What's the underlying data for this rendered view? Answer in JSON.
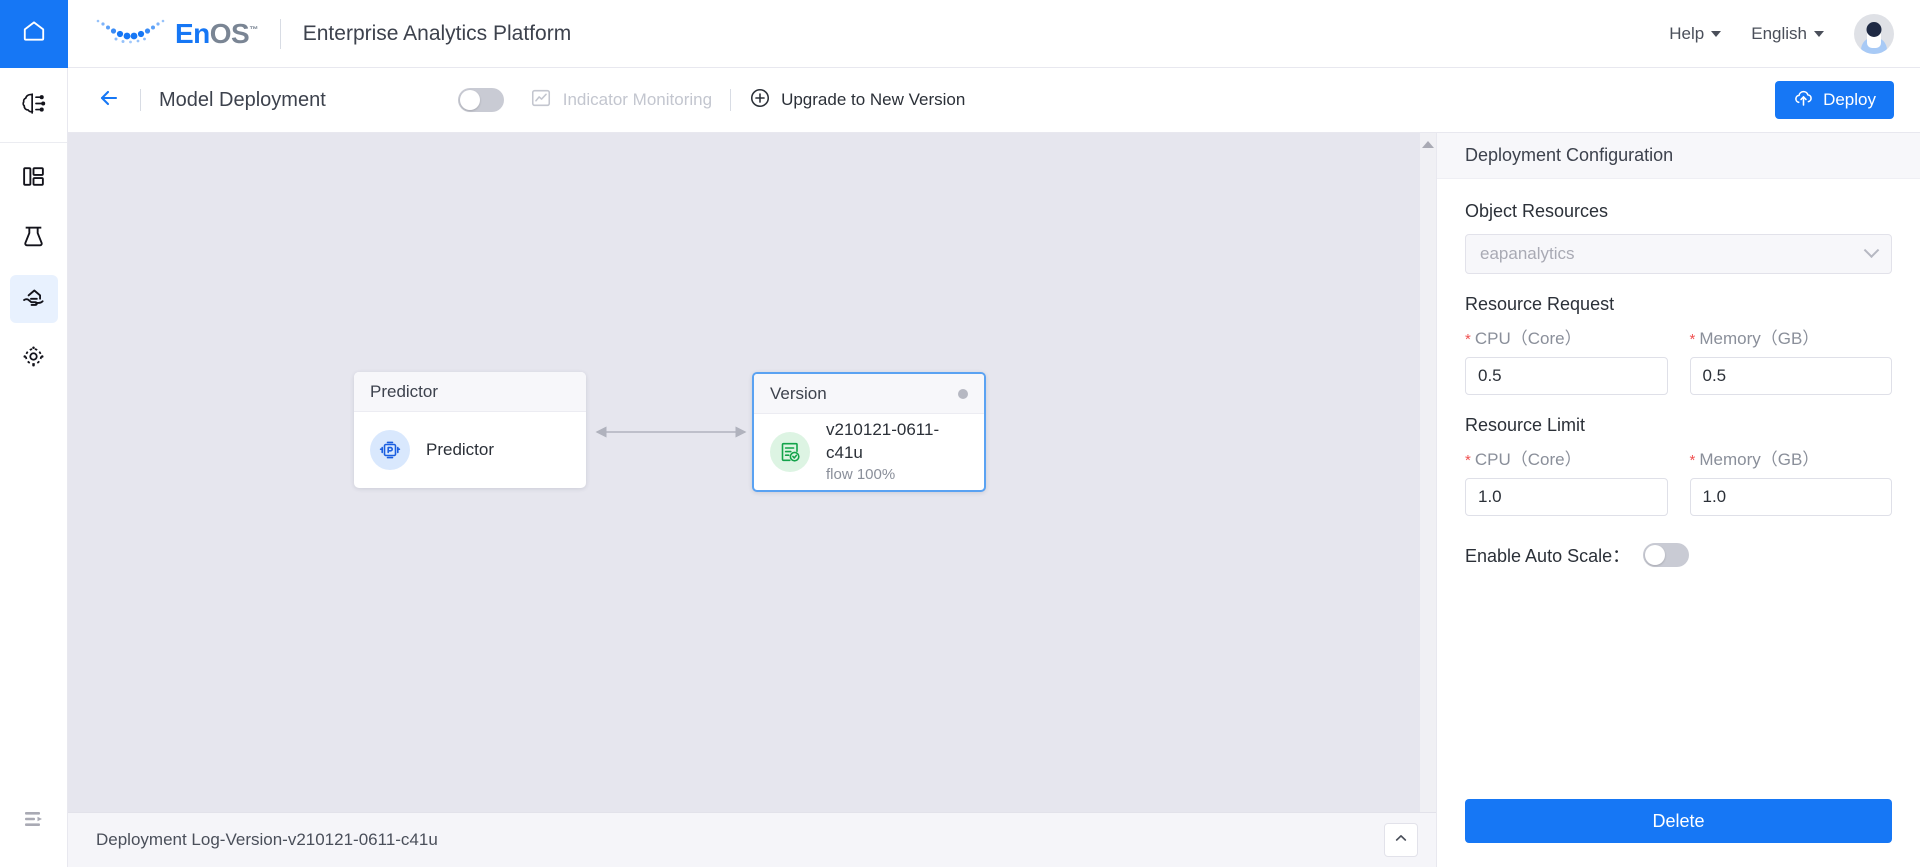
{
  "header": {
    "home_icon": "home-icon",
    "logo_en": "En",
    "logo_os": "OS",
    "logo_tm": "™",
    "platform_title": "Enterprise Analytics Platform",
    "help_label": "Help",
    "language_label": "English",
    "avatar_icon": "user-avatar-icon"
  },
  "sidebar": {
    "items": [
      {
        "name": "sidebar-item-ai-model",
        "icon": "brain-network-icon",
        "active": false
      },
      {
        "name": "sidebar-item-dashboard",
        "icon": "dashboard-grid-icon",
        "active": false
      },
      {
        "name": "sidebar-item-lab",
        "icon": "flask-icon",
        "active": false
      },
      {
        "name": "sidebar-item-deployment",
        "icon": "hand-deploy-icon",
        "active": true
      },
      {
        "name": "sidebar-item-settings",
        "icon": "gear-target-icon",
        "active": false
      }
    ],
    "collapse_icon": "collapse-sidebar-icon"
  },
  "toolbar": {
    "back_icon": "back-arrow-icon",
    "page_title": "Model Deployment",
    "monitor_toggle_state": "off",
    "indicator_monitoring_label": "Indicator Monitoring",
    "indicator_monitoring_icon": "chart-monitor-icon",
    "upgrade_label": "Upgrade to New Version",
    "upgrade_icon": "plus-circle-icon",
    "deploy_label": "Deploy",
    "deploy_icon": "cloud-upload-icon",
    "accent_color": "#1677f5"
  },
  "canvas": {
    "background_color": "#e6e6ee",
    "nodes": [
      {
        "name": "node-predictor",
        "header": "Predictor",
        "icon": "predictor-machine-icon",
        "title": "Predictor",
        "subtitle": "",
        "selected": false,
        "has_status_dot": false
      },
      {
        "name": "node-version",
        "header": "Version",
        "icon": "version-document-check-icon",
        "title": "v210121-0611-c41u",
        "subtitle": "flow 100%",
        "selected": true,
        "has_status_dot": true,
        "status_dot_color": "#b6b8c2"
      }
    ],
    "connector": "bidirectional-arrow"
  },
  "log_bar": {
    "title": "Deployment Log-Version-v210121-0611-c41u",
    "expand_icon": "chevron-up-icon"
  },
  "panel": {
    "title": "Deployment Configuration",
    "object_resources_label": "Object Resources",
    "object_resources_value": "eapanalytics",
    "resource_request_label": "Resource Request",
    "resource_limit_label": "Resource Limit",
    "cpu_label": "CPU（Core）",
    "memory_label": "Memory（GB）",
    "required_star": "*",
    "request_cpu_value": "0.5",
    "request_memory_value": "0.5",
    "limit_cpu_value": "1.0",
    "limit_memory_value": "1.0",
    "auto_scale_label": "Enable Auto Scale：",
    "auto_scale_state": "off",
    "delete_label": "Delete"
  }
}
